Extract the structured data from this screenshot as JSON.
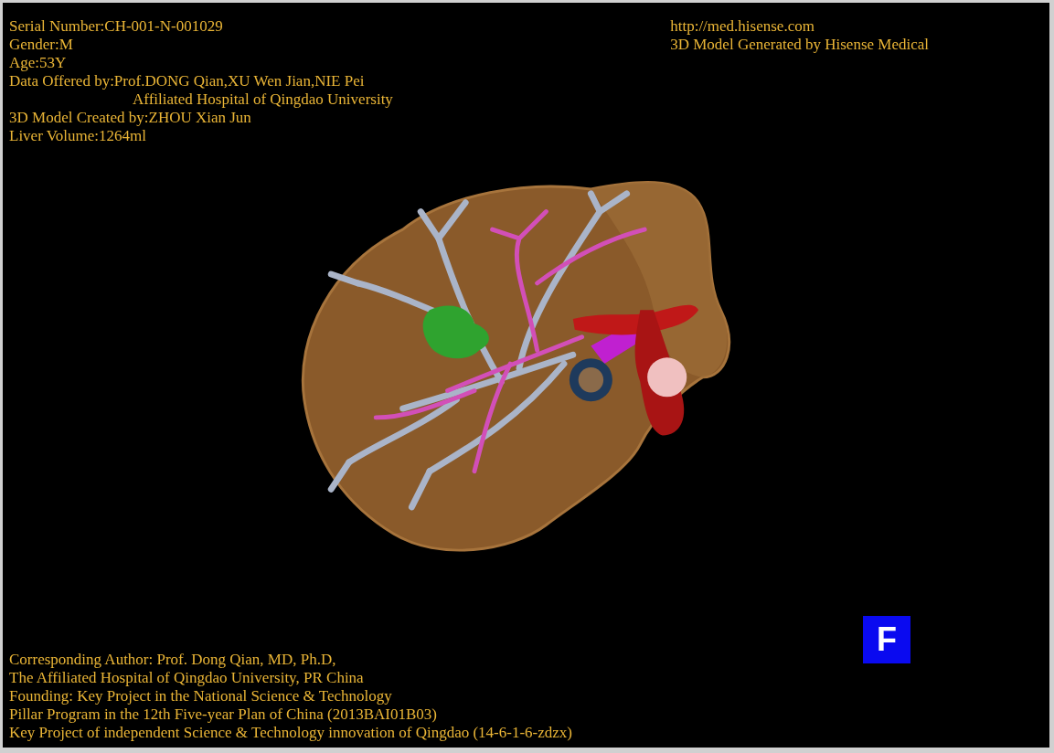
{
  "patient_info": [
    {
      "kind": "line",
      "text": "Serial Number:CH-001-N-001029"
    },
    {
      "kind": "line",
      "text": "Gender:M"
    },
    {
      "kind": "line",
      "text": "Age:53Y"
    },
    {
      "kind": "line",
      "text": "Data Offered by:Prof.DONG Qian,XU Wen Jian,NIE Pei"
    },
    {
      "kind": "indented",
      "text": "Affiliated Hospital of Qingdao University"
    },
    {
      "kind": "line",
      "text": "3D Model Created by:ZHOU Xian Jun"
    },
    {
      "kind": "line",
      "text": "Liver Volume:1264ml"
    }
  ],
  "vendor_info": [
    "http://med.hisense.com",
    "3D Model Generated by Hisense Medical"
  ],
  "credits": [
    "Corresponding Author: Prof. Dong Qian, MD, Ph.D,",
    "The Affiliated Hospital of Qingdao University, PR China",
    "Founding: Key Project in the National Science & Technology",
    "Pillar Program in the 12th Five-year Plan of China (2013BAI01B03)",
    "Key Project of independent Science & Technology innovation of Qingdao (14-6-1-6-zdzx)"
  ],
  "view_orientation": "F"
}
